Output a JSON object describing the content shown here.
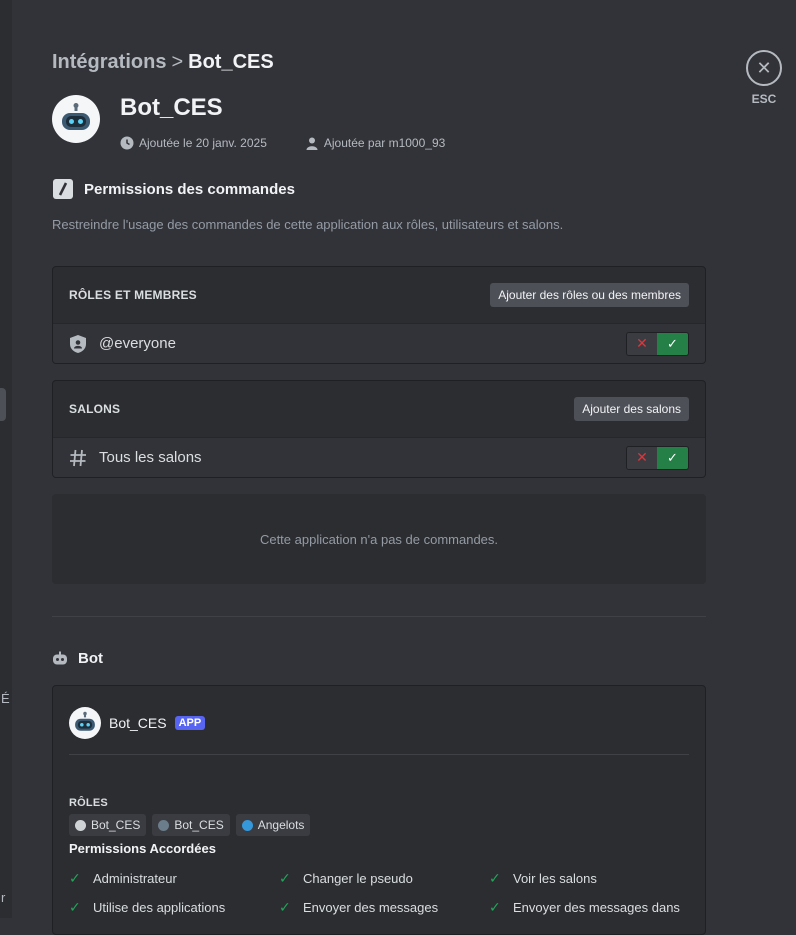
{
  "breadcrumb": {
    "parent": "Intégrations",
    "separator": ">",
    "current": "Bot_CES"
  },
  "close": {
    "label": "ESC"
  },
  "app": {
    "name": "Bot_CES",
    "added_on": "Ajoutée le 20 janv. 2025",
    "added_by": "Ajoutée par m1000_93"
  },
  "command_permissions": {
    "title": "Permissions des commandes",
    "description": "Restreindre l'usage des commandes de cette application aux rôles, utilisateurs et salons.",
    "roles_members": {
      "header": "RÔLES ET MEMBRES",
      "add_button": "Ajouter des rôles ou des membres",
      "rows": [
        {
          "label": "@everyone",
          "state": "allowed"
        }
      ]
    },
    "channels": {
      "header": "SALONS",
      "add_button": "Ajouter des salons",
      "rows": [
        {
          "label": "Tous les salons",
          "state": "allowed"
        }
      ]
    },
    "empty_message": "Cette application n'a pas de commandes."
  },
  "bot_section": {
    "title": "Bot",
    "bot_name": "Bot_CES",
    "badge": "APP",
    "roles_header": "RÔLES",
    "roles": [
      {
        "name": "Bot_CES",
        "color": "#d0d3d6"
      },
      {
        "name": "Bot_CES",
        "color": "#6b7c8a"
      },
      {
        "name": "Angelots",
        "color": "#3498db"
      }
    ],
    "permissions_header": "Permissions Accordées",
    "permissions": [
      "Administrateur",
      "Changer le pseudo",
      "Voir les salons",
      "Utilise des applications",
      "Envoyer des messages",
      "Envoyer des messages dans"
    ]
  },
  "left_fragments": {
    "a": "É",
    "b": "r"
  },
  "colors": {
    "allow": "#248046",
    "deny": "#da373c",
    "badge": "#5865f2",
    "check": "#23a55a"
  }
}
